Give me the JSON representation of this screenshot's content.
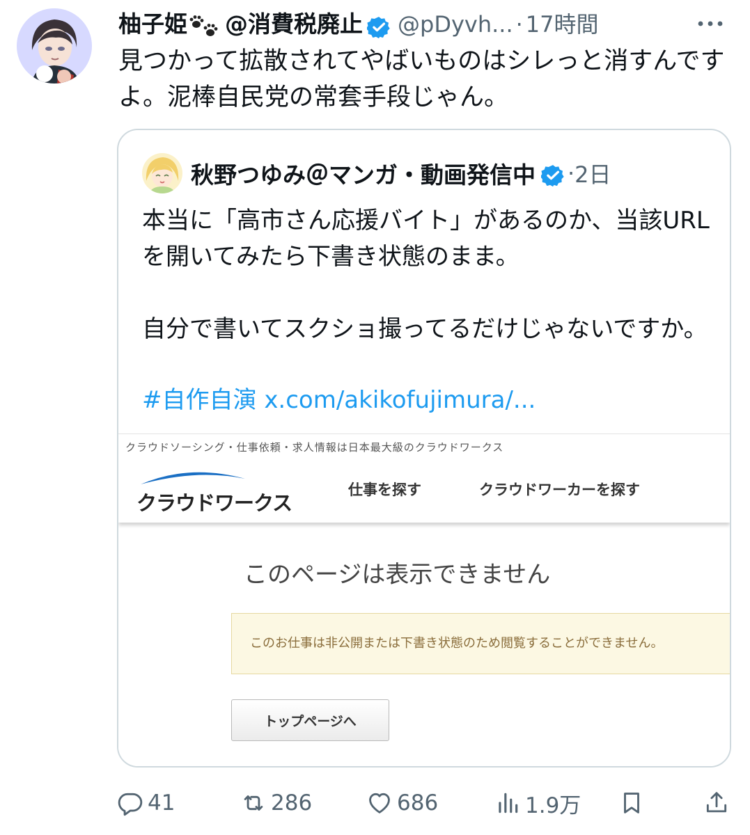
{
  "post": {
    "display_name": "柚子姫",
    "name_suffix": "@消費税廃止",
    "handle": "@pDyvh...",
    "separator": "·",
    "timestamp": "17時間",
    "text": "見つかって拡散されてやばいものはシレっと消すんですよ。泥棒自民党の常套手段じゃん。"
  },
  "quote": {
    "display_name": "秋野つゆみ＠マンガ・動画発信中",
    "separator": "·",
    "timestamp": "2日",
    "text": "本当に「高市さん応援バイト」があるのか、当該URLを開いてみたら下書き状態のまま。\n\n自分で書いてスクショ撮ってるだけじゃないですか。",
    "hashtag": "#自作自演",
    "link": "x.com/akikofujimura/..."
  },
  "screenshot": {
    "tagline": "クラウドソーシング・仕事依頼・求人情報は日本最大級のクラウドワークス",
    "logo_text": "クラウドワークス",
    "nav_find_jobs": "仕事を探す",
    "nav_find_workers": "クラウドワーカーを探す",
    "error_title": "このページは表示できません",
    "notice": "このお仕事は非公開または下書き状態のため閲覧することができません。",
    "button": "トップページへ"
  },
  "actions": {
    "replies": "41",
    "reposts": "286",
    "likes": "686",
    "views": "1.9万"
  },
  "icons": {
    "verified": "verified-badge-icon",
    "paws": "paw-prints-icon",
    "more": "more-icon",
    "reply": "reply-icon",
    "repost": "repost-icon",
    "like": "heart-icon",
    "views": "views-chart-icon",
    "bookmark": "bookmark-icon",
    "share": "share-icon"
  },
  "colors": {
    "accent": "#1d9bf0",
    "text": "#0f1419",
    "muted": "#536471",
    "border": "#cfd9de",
    "notice_bg": "#fcf8e3",
    "notice_text": "#8a6d3b",
    "logo_blue": "#1a6fc4"
  }
}
